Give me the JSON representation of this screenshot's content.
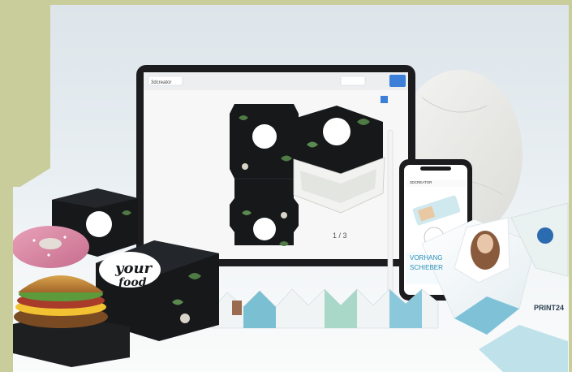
{
  "colors": {
    "frame": "#c9cc9b",
    "backdrop": "#e6ecef",
    "box_dark": "#16181a",
    "leaf_green": "#4f7a45",
    "tablet_bezel": "#1c1c1e",
    "screen_bg": "#f7f7f7",
    "accent_blue": "#3b7fd9",
    "marble": "#eeeeec"
  },
  "tablet": {
    "tab_label": "3dcreator",
    "pagination": "1 / 3"
  },
  "box_brand": {
    "line1": "your",
    "line2": "food"
  },
  "phone": {
    "header": "3DCREATOR",
    "banner_text_1": "VORHANG",
    "banner_text_2": "SCHIEBER"
  },
  "flyer": {
    "brand": "PRINT24"
  }
}
